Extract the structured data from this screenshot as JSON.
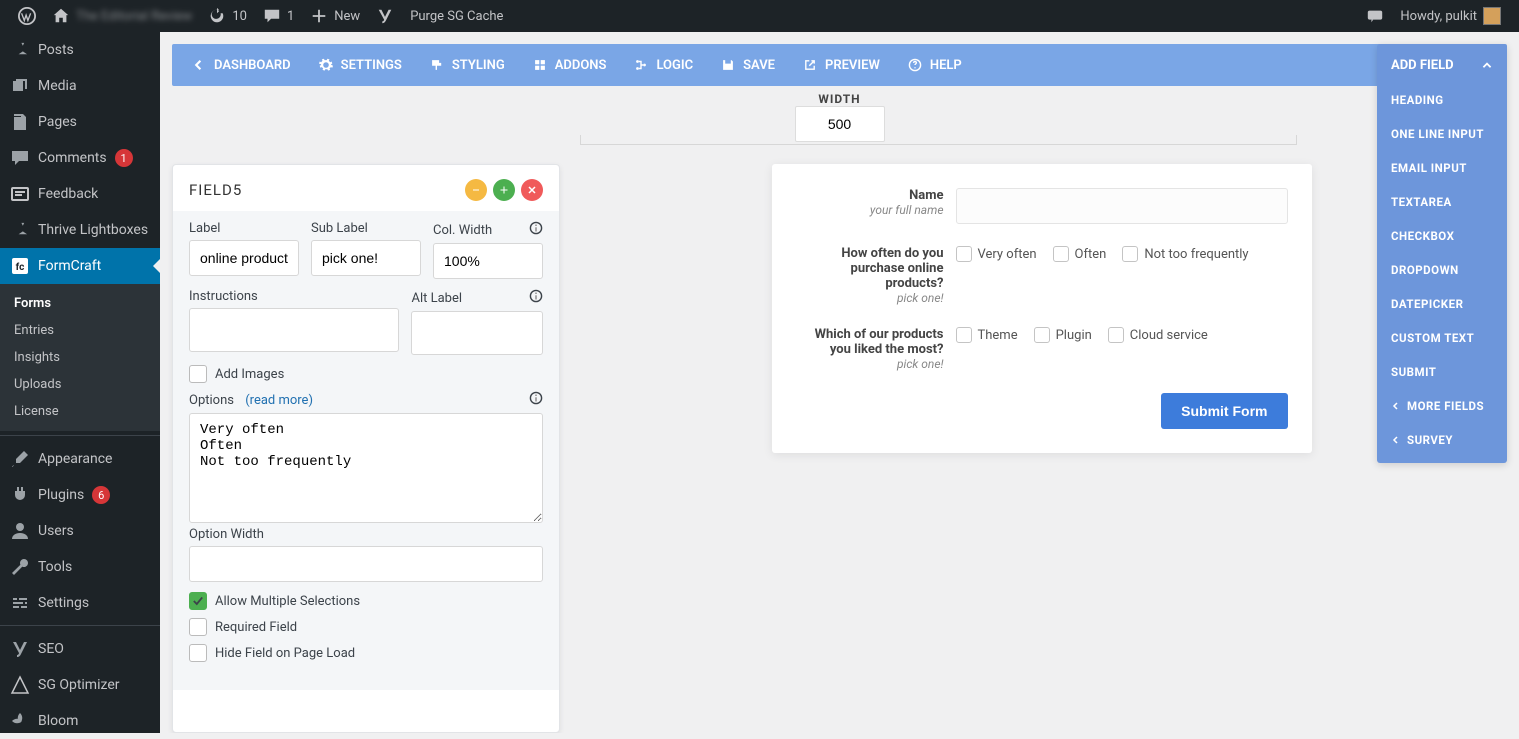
{
  "adminbar": {
    "site_name": "The Editorial Review",
    "updates": "10",
    "comments": "1",
    "new": "New",
    "purge": "Purge SG Cache",
    "howdy": "Howdy, pulkit"
  },
  "sidebar": {
    "items": [
      {
        "label": "Posts",
        "icon": "pin"
      },
      {
        "label": "Media",
        "icon": "media"
      },
      {
        "label": "Pages",
        "icon": "page"
      },
      {
        "label": "Comments",
        "icon": "comment",
        "badge": "1"
      },
      {
        "label": "Feedback",
        "icon": "feedback"
      },
      {
        "label": "Thrive Lightboxes",
        "icon": "pin"
      }
    ],
    "active": {
      "label": "FormCraft",
      "icon": "fc"
    },
    "sub": [
      "Forms",
      "Entries",
      "Insights",
      "Uploads",
      "License"
    ],
    "sub_current": 0,
    "lower": [
      {
        "label": "Appearance",
        "icon": "brush"
      },
      {
        "label": "Plugins",
        "icon": "plug",
        "badge": "6"
      },
      {
        "label": "Users",
        "icon": "user"
      },
      {
        "label": "Tools",
        "icon": "wrench"
      },
      {
        "label": "Settings",
        "icon": "sliders"
      }
    ],
    "extra": [
      {
        "label": "SEO",
        "icon": "yoast"
      },
      {
        "label": "SG Optimizer",
        "icon": "sg"
      },
      {
        "label": "Bloom",
        "icon": "bloom"
      }
    ]
  },
  "toolbar": {
    "items": [
      "DASHBOARD",
      "SETTINGS",
      "STYLING",
      "ADDONS",
      "LOGIC",
      "SAVE",
      "PREVIEW",
      "HELP"
    ]
  },
  "width": {
    "label": "WIDTH",
    "value": "500"
  },
  "field_panel": {
    "title": "FIELD5",
    "labels": {
      "label": "Label",
      "sublabel": "Sub Label",
      "colwidth": "Col. Width",
      "instructions": "Instructions",
      "altlabel": "Alt Label",
      "addimages": "Add Images",
      "options": "Options",
      "readmore": "(read more)",
      "optionwidth": "Option Width",
      "allowmulti": "Allow Multiple Selections",
      "required": "Required Field",
      "hide": "Hide Field on Page Load"
    },
    "values": {
      "label": "online products?",
      "sublabel": "pick one!",
      "colwidth": "100%",
      "instructions": "",
      "altlabel": "",
      "options": "Very often\nOften\nNot too frequently",
      "optionwidth": ""
    },
    "checks": {
      "addimages": false,
      "allowmulti": true,
      "required": false,
      "hide": false
    }
  },
  "preview": {
    "fields": [
      {
        "label": "Name",
        "sub": "your full name",
        "type": "text"
      },
      {
        "label": "How often do you purchase online products?",
        "sub": "pick one!",
        "type": "checkbox",
        "options": [
          "Very often",
          "Often",
          "Not too frequently"
        ]
      },
      {
        "label": "Which of our products you liked the most?",
        "sub": "pick one!",
        "type": "checkbox",
        "options": [
          "Theme",
          "Plugin",
          "Cloud service"
        ]
      }
    ],
    "submit": "Submit Form"
  },
  "addfield": {
    "title": "ADD FIELD",
    "items": [
      "HEADING",
      "ONE LINE INPUT",
      "EMAIL INPUT",
      "TEXTAREA",
      "CHECKBOX",
      "DROPDOWN",
      "DATEPICKER",
      "CUSTOM TEXT",
      "SUBMIT"
    ],
    "more": "MORE FIELDS",
    "survey": "SURVEY"
  }
}
